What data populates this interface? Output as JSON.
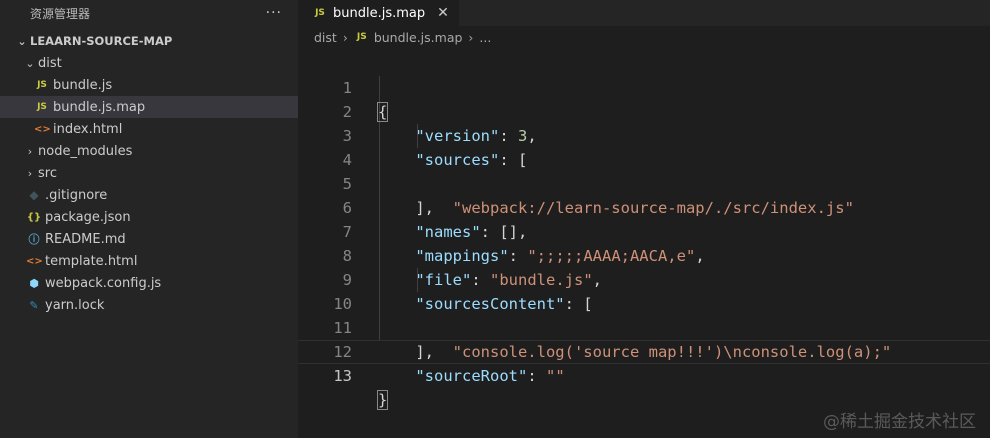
{
  "sidebar": {
    "title": "资源管理器",
    "more": "···",
    "project": "LEAARN-SOURCE-MAP",
    "items": [
      {
        "label": "dist",
        "type": "folder-open",
        "icon": "chevron-down-icon"
      },
      {
        "label": "bundle.js",
        "type": "js",
        "icon": "JS"
      },
      {
        "label": "bundle.js.map",
        "type": "js",
        "icon": "JS"
      },
      {
        "label": "index.html",
        "type": "html",
        "icon": "<>"
      },
      {
        "label": "node_modules",
        "type": "folder",
        "icon": "chevron-right-icon"
      },
      {
        "label": "src",
        "type": "folder",
        "icon": "chevron-right-icon"
      },
      {
        "label": ".gitignore",
        "type": "git",
        "icon": "◆"
      },
      {
        "label": "package.json",
        "type": "json",
        "icon": "{}"
      },
      {
        "label": "README.md",
        "type": "md",
        "icon": "ⓘ"
      },
      {
        "label": "template.html",
        "type": "html",
        "icon": "<>"
      },
      {
        "label": "webpack.config.js",
        "type": "webpack",
        "icon": "⬢"
      },
      {
        "label": "yarn.lock",
        "type": "yarn",
        "icon": "🐈"
      }
    ]
  },
  "tab": {
    "icon": "JS",
    "label": "bundle.js.map",
    "close": "✕"
  },
  "breadcrumb": {
    "part1": "dist",
    "sep": "›",
    "icon": "JS",
    "part2": "bundle.js.map",
    "ellipsis": "..."
  },
  "code": {
    "line_numbers": [
      "1",
      "2",
      "3",
      "4",
      "5",
      "6",
      "7",
      "8",
      "9",
      "10",
      "11",
      "12",
      "13"
    ],
    "current_line": 13
  },
  "watermark": "@稀土掘金技术社区",
  "colors": {
    "key": "#9cdcfe",
    "string": "#ce9178",
    "number": "#b5cea8",
    "selected_row": "#37373d"
  }
}
